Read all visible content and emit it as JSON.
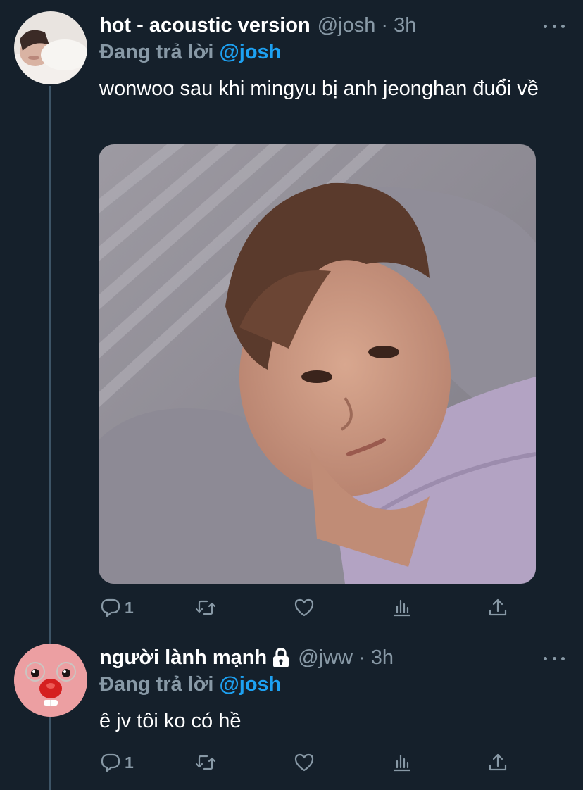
{
  "tweets": [
    {
      "name": "hot - acoustic version",
      "handle_time": "@josh · 3h",
      "replying_prefix": "Đang trả lời",
      "replying_mention": "@josh",
      "text": "wonwoo sau khi mingyu bị anh jeonghan đuổi về",
      "actions": {
        "reply_count": "1",
        "retweet_count": "",
        "like_count": ""
      }
    },
    {
      "name": "người lành mạnh",
      "locked": true,
      "handle_time": "@jww · 3h",
      "replying_prefix": "Đang trả lời",
      "replying_mention": "@josh",
      "text": "ê jv tôi ko có hề",
      "actions": {
        "reply_count": "1",
        "retweet_count": "",
        "like_count": ""
      }
    }
  ],
  "colors": {
    "background": "#15202b",
    "secondary_text": "#8899a6",
    "accent": "#1da1f2",
    "thread_line": "#3d5466"
  },
  "icons": [
    "reply-icon",
    "retweet-icon",
    "like-icon",
    "analytics-icon",
    "share-icon",
    "more-icon",
    "lock-icon"
  ]
}
